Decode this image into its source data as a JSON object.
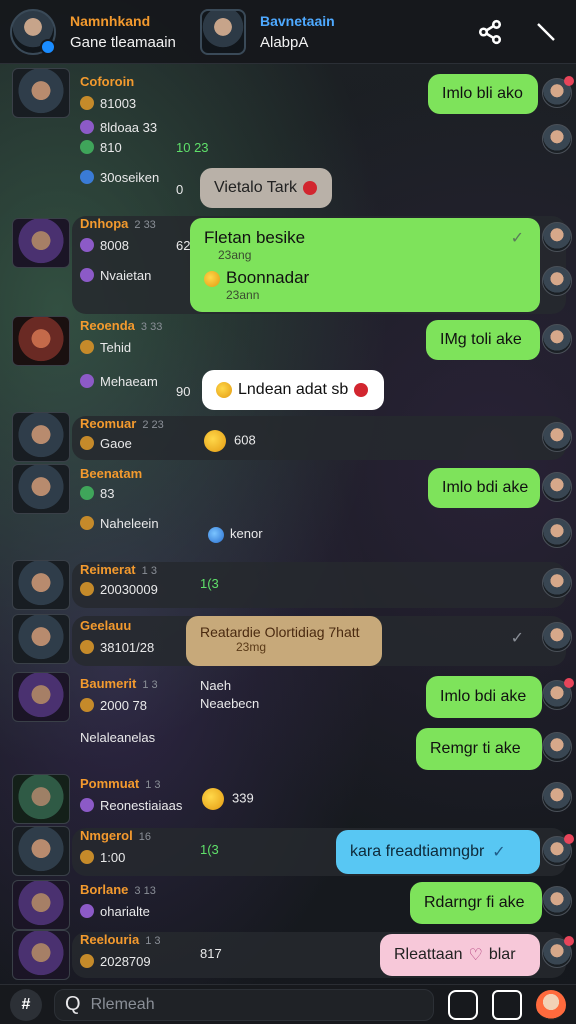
{
  "header": {
    "contact1": {
      "name": "Namnhkand",
      "sub": "Gane tleamaain"
    },
    "contact2": {
      "name": "Bavnetaain",
      "sub": "AlabpA"
    },
    "icons": [
      "share-icon",
      "edit-icon"
    ]
  },
  "rows": [
    {
      "name": "Coforoin",
      "time": "",
      "meta1": "81003",
      "meta2": "8ldoaa 33",
      "bubble": "Imlo bli ako",
      "bubbleColor": "green"
    },
    {
      "meta": "810",
      "inline": "10 23",
      "bubble": "",
      "bubbleColor": ""
    },
    {
      "meta": "30oseiken",
      "inline": "0",
      "bubble": "Vietalo Tark",
      "bubbleColor": "grey"
    },
    {
      "name": "Dnhopa",
      "time": "2 33",
      "meta1": "8008",
      "inline": "62",
      "bubble": "Fletan besike",
      "bubbleSub": "23ang",
      "bubble2": "Boonnadar",
      "bubbleSub2": "23ann",
      "bubbleColor": "green"
    },
    {
      "meta": "Nvaietan",
      "bubble": "",
      "bubbleColor": ""
    },
    {
      "name": "Reoenda",
      "time": "3 33",
      "meta1": "Tehid",
      "bubble": "IMg toli ake",
      "bubbleColor": "green"
    },
    {
      "meta": "Mehaeam",
      "inline": "90",
      "bubble": "Lndean adat sb",
      "bubbleColor": "white"
    },
    {
      "name": "Reomuar",
      "time": "2 23",
      "meta1": "Gaoe",
      "inline": "608",
      "bubbleColor": ""
    },
    {
      "name": "Beenatam",
      "time": "",
      "meta1": "83",
      "bubble": "Imlo bdi ake",
      "bubbleColor": "green"
    },
    {
      "meta": "Naheleein",
      "inline": "kenor",
      "bubbleColor": ""
    },
    {
      "name": "Reimerat",
      "time": "1 3",
      "meta1": "20030009",
      "inline": "1(3",
      "bubbleColor": ""
    },
    {
      "name": "Geelauu",
      "time": "",
      "meta1": "38101/28",
      "bubble": "Reatardie Olortidiag 7hatt",
      "bubbleSub": "23mg",
      "bubbleColor": "tan"
    },
    {
      "name": "Baumerit",
      "time": "1 3",
      "meta1": "2000 78",
      "inline": "Naeh",
      "inline2": "Neaebecn",
      "bubble": "Imlo bdi ake",
      "bubbleColor": "green"
    },
    {
      "meta": "Nelaleanelas",
      "bubble": "Remgr ti ake",
      "bubbleColor": "green"
    },
    {
      "name": "Pommuat",
      "time": "1 3",
      "meta1": "Reonestiaiaas",
      "inline": "339",
      "bubbleColor": ""
    },
    {
      "name": "Nmgerol",
      "time": "16",
      "meta1": "1:00",
      "inline": "1(3",
      "bubble": "kara freadtiamngbr",
      "bubbleColor": "blue"
    },
    {
      "name": "Borlane",
      "time": "3 13",
      "meta1": "oharialte",
      "bubble": "Rdarngr fi ake",
      "bubbleColor": "green"
    },
    {
      "name": "Reelouria",
      "time": "1 3",
      "meta1": "2028709",
      "inline": "817",
      "bubble": "Rleattaan",
      "bubbleTail": "blar",
      "bubbleColor": "pink"
    }
  ],
  "bottom": {
    "placeholder": "Rlemeah"
  }
}
